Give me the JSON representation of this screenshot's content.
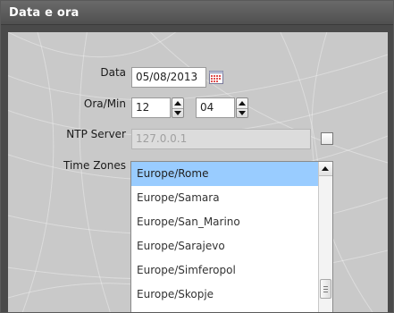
{
  "window": {
    "title": "Data e ora"
  },
  "form": {
    "date": {
      "label": "Data",
      "value": "05/08/2013",
      "icon": "calendar-icon"
    },
    "time": {
      "label": "Ora/Min",
      "hour": "12",
      "minute": "04"
    },
    "ntp": {
      "label": "NTP Server",
      "value": "127.0.0.1",
      "enabled": false
    },
    "timezones": {
      "label": "Time Zones",
      "selected": "Europe/Rome",
      "items": [
        "Europe/Rome",
        "Europe/Samara",
        "Europe/San_Marino",
        "Europe/Sarajevo",
        "Europe/Simferopol",
        "Europe/Skopje"
      ]
    }
  },
  "colors": {
    "titlebar": "#555555",
    "panel": "#c9c9c9",
    "selection": "#99ccff"
  }
}
